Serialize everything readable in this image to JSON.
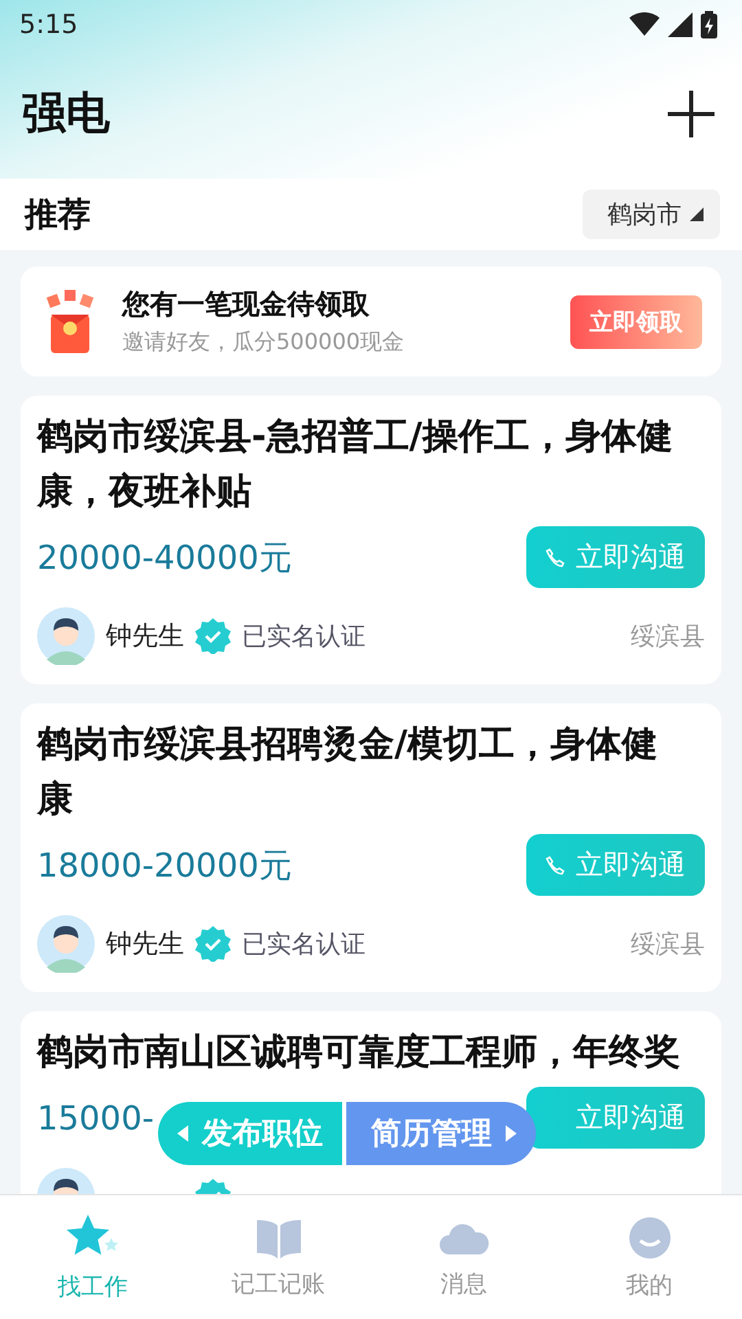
{
  "status_bar": {
    "time": "5:15"
  },
  "header": {
    "title": "强电"
  },
  "filter": {
    "label": "推荐",
    "city": "鹤岗市"
  },
  "promo": {
    "title": "您有一笔现金待领取",
    "subtitle": "邀请好友，瓜分500000现金",
    "button": "立即领取"
  },
  "jobs": [
    {
      "title": "鹤岗市绥滨县-急招普工/操作工，身体健康，夜班补贴",
      "salary": "20000-40000元",
      "button": "立即沟通",
      "phone_icon": true,
      "poster": "钟先生",
      "verified": true,
      "verify_text": "已实名认证",
      "location": "绥滨县"
    },
    {
      "title": "鹤岗市绥滨县招聘烫金/模切工，身体健康",
      "salary": "18000-20000元",
      "button": "立即沟通",
      "phone_icon": true,
      "poster": "钟先生",
      "verified": true,
      "verify_text": "已实名认证",
      "location": "绥滨县"
    },
    {
      "title": "鹤岗市南山区诚聘可靠度工程师，年终奖",
      "salary": "15000-",
      "button": "立即沟通",
      "phone_icon": false,
      "verified": true
    }
  ],
  "float_actions": {
    "left": "发布职位",
    "right": "简历管理"
  },
  "tabs": [
    {
      "label": "找工作",
      "kind": "star",
      "selected": true
    },
    {
      "label": "记工记账",
      "kind": "book",
      "selected": false
    },
    {
      "label": "消息",
      "kind": "cloud",
      "selected": false
    },
    {
      "label": "我的",
      "kind": "face",
      "selected": false
    }
  ]
}
